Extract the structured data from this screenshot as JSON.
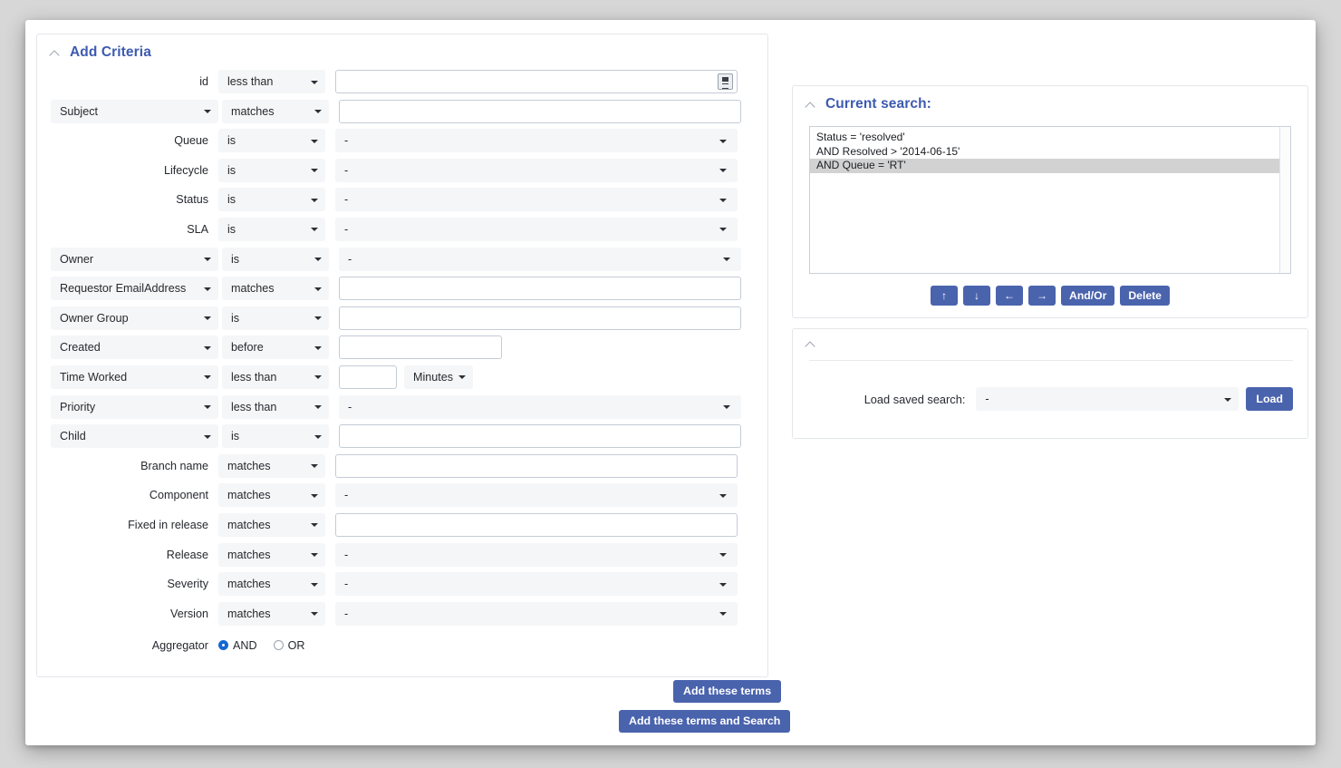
{
  "criteria_panel": {
    "title": "Add Criteria",
    "rows": [
      {
        "label": "id",
        "label_is_select": false,
        "operator": "less than",
        "value_type": "input-picker",
        "value": "",
        "placeholder": ""
      },
      {
        "label": "Subject",
        "label_is_select": true,
        "operator": "matches",
        "value_type": "input",
        "value": "",
        "placeholder": ""
      },
      {
        "label": "Queue",
        "label_is_select": false,
        "operator": "is",
        "value_type": "select",
        "value": "-"
      },
      {
        "label": "Lifecycle",
        "label_is_select": false,
        "operator": "is",
        "value_type": "select",
        "value": "-"
      },
      {
        "label": "Status",
        "label_is_select": false,
        "operator": "is",
        "value_type": "select",
        "value": "-"
      },
      {
        "label": "SLA",
        "label_is_select": false,
        "operator": "is",
        "value_type": "select",
        "value": "-"
      },
      {
        "label": "Owner",
        "label_is_select": true,
        "operator": "is",
        "value_type": "select",
        "value": "-"
      },
      {
        "label": "Requestor EmailAddress",
        "label_is_select": true,
        "operator": "matches",
        "value_type": "input",
        "value": "",
        "placeholder": ""
      },
      {
        "label": "Owner Group",
        "label_is_select": true,
        "operator": "is",
        "value_type": "input",
        "value": "",
        "placeholder": ""
      },
      {
        "label": "Created",
        "label_is_select": true,
        "operator": "before",
        "value_type": "input-date",
        "value": "",
        "placeholder": ""
      },
      {
        "label": "Time Worked",
        "label_is_select": true,
        "operator": "less than",
        "value_type": "input-unit",
        "value": "",
        "placeholder": "",
        "unit": "Minutes"
      },
      {
        "label": "Priority",
        "label_is_select": true,
        "operator": "less than",
        "value_type": "select",
        "value": "-"
      },
      {
        "label": "Child",
        "label_is_select": true,
        "operator": "is",
        "value_type": "input",
        "value": "",
        "placeholder": ""
      },
      {
        "label": "Branch name",
        "label_is_select": false,
        "operator": "matches",
        "value_type": "input",
        "value": "",
        "placeholder": ""
      },
      {
        "label": "Component",
        "label_is_select": false,
        "operator": "matches",
        "value_type": "select",
        "value": "-"
      },
      {
        "label": "Fixed in release",
        "label_is_select": false,
        "operator": "matches",
        "value_type": "input",
        "value": "",
        "placeholder": ""
      },
      {
        "label": "Release",
        "label_is_select": false,
        "operator": "matches",
        "value_type": "select",
        "value": "-"
      },
      {
        "label": "Severity",
        "label_is_select": false,
        "operator": "matches",
        "value_type": "select",
        "value": "-"
      },
      {
        "label": "Version",
        "label_is_select": false,
        "operator": "matches",
        "value_type": "select",
        "value": "-"
      }
    ],
    "aggregator": {
      "label": "Aggregator",
      "options": [
        {
          "label": "AND",
          "selected": true
        },
        {
          "label": "OR",
          "selected": false
        }
      ]
    }
  },
  "current_search": {
    "title": "Current search:",
    "items": [
      {
        "text": "Status = 'resolved'",
        "selected": false
      },
      {
        "text": "AND Resolved > '2014-06-15'",
        "selected": false
      },
      {
        "text": "AND Queue = 'RT'",
        "selected": true
      }
    ],
    "toolbar": {
      "move_up": "↑",
      "move_down": "↓",
      "move_left": "←",
      "move_right": "→",
      "and_or": "And/Or",
      "delete": "Delete"
    }
  },
  "load_search": {
    "label": "Load saved search:",
    "selected": "-",
    "load_button": "Load"
  },
  "actions": {
    "add_terms": "Add these terms",
    "add_terms_and_search": "Add these terms and Search"
  },
  "colors": {
    "accent_blue": "#3c5ab0",
    "button_blue": "#4a63ad",
    "radio_blue": "#1567d3",
    "field_grey": "#f5f6f8",
    "selected_row": "#d2d2d2"
  }
}
